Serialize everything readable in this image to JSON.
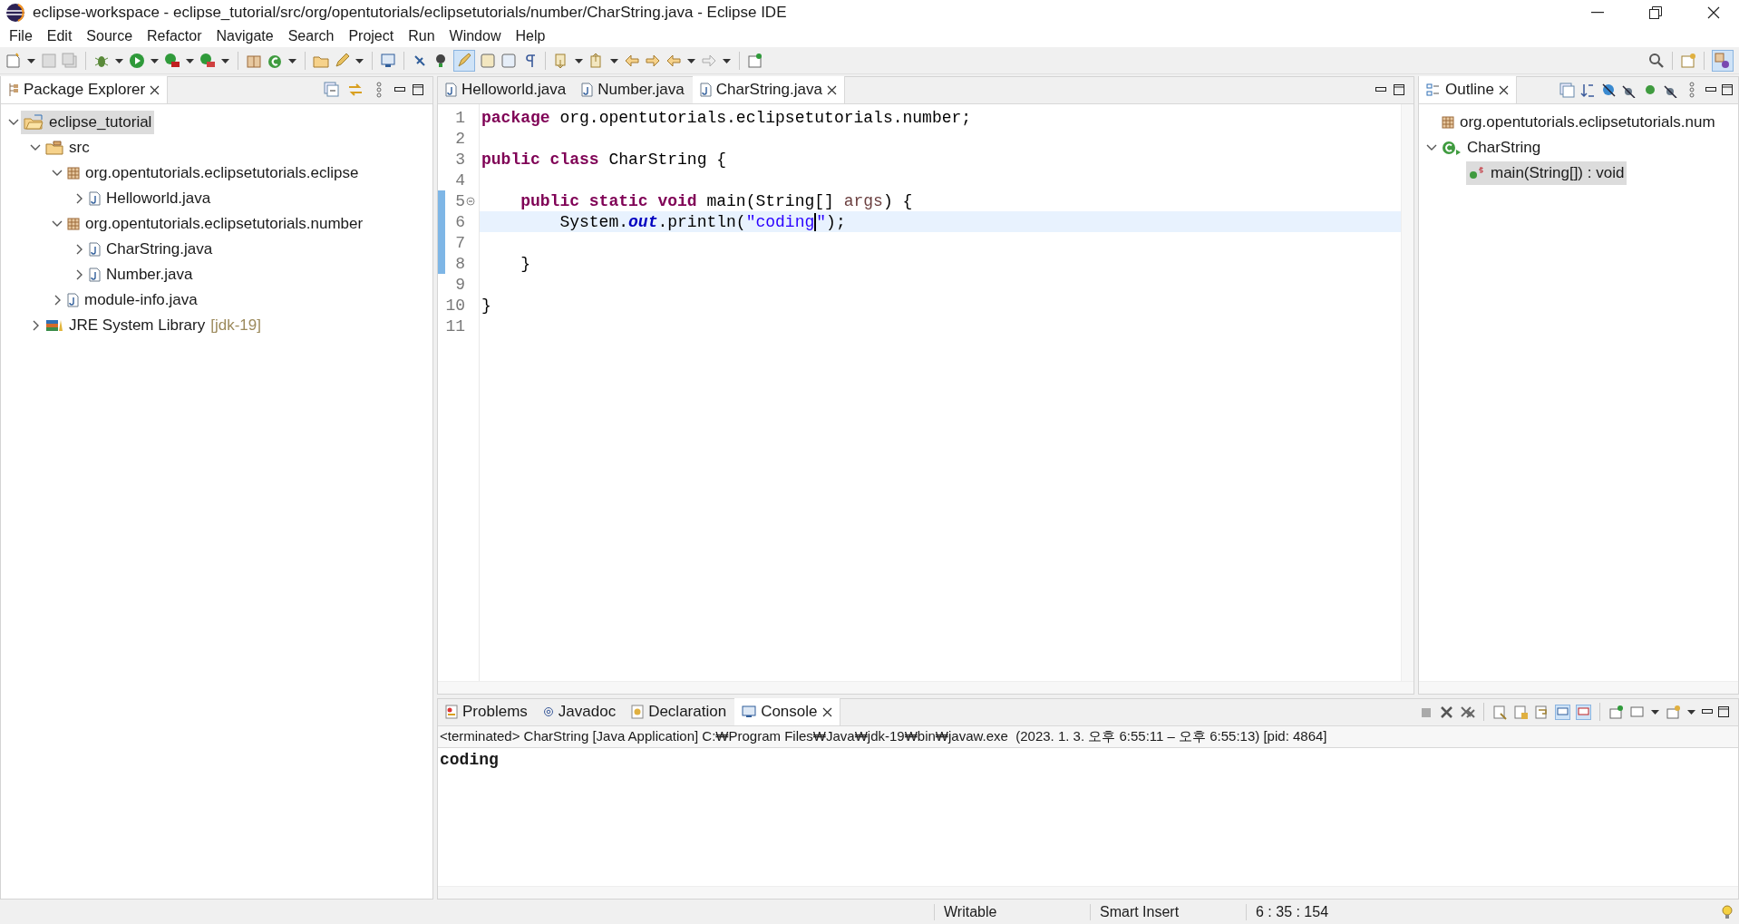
{
  "window": {
    "title": "eclipse-workspace - eclipse_tutorial/src/org/opentutorials/eclipsetutorials/number/CharString.java - Eclipse IDE"
  },
  "menu": [
    "File",
    "Edit",
    "Source",
    "Refactor",
    "Navigate",
    "Search",
    "Project",
    "Run",
    "Window",
    "Help"
  ],
  "package_explorer": {
    "title": "Package Explorer",
    "tree": [
      {
        "label": "eclipse_tutorial",
        "kind": "project",
        "expanded": true,
        "selected": true,
        "children": [
          {
            "label": "src",
            "kind": "folder",
            "expanded": true,
            "selected": false,
            "children": [
              {
                "label": "org.opentutorials.eclipsetutorials.eclipse",
                "kind": "package",
                "expanded": true,
                "selected": false,
                "children": [
                  {
                    "label": "Helloworld.java",
                    "kind": "java",
                    "expanded": false,
                    "selected": false
                  }
                ]
              },
              {
                "label": "org.opentutorials.eclipsetutorials.number",
                "kind": "package",
                "expanded": true,
                "selected": false,
                "children": [
                  {
                    "label": "CharString.java",
                    "kind": "java",
                    "expanded": false,
                    "selected": false
                  },
                  {
                    "label": "Number.java",
                    "kind": "java",
                    "expanded": false,
                    "selected": false
                  }
                ]
              },
              {
                "label": "module-info.java",
                "kind": "java",
                "expanded": false,
                "selected": false
              }
            ]
          },
          {
            "label": "JRE System Library",
            "suffix": "[jdk-19]",
            "kind": "library",
            "expanded": false,
            "selected": false
          }
        ]
      }
    ]
  },
  "editor": {
    "tabs": [
      {
        "label": "Helloworld.java",
        "selected": false
      },
      {
        "label": "Number.java",
        "selected": false
      },
      {
        "label": "CharString.java",
        "selected": true
      }
    ],
    "lines": [
      {
        "number": "1",
        "current": false,
        "marked": false,
        "tokens": [
          {
            "kind": "keyword",
            "text": "package"
          },
          {
            "kind": "plain",
            "text": " org.opentutorials.eclipsetutorials.number;"
          }
        ]
      },
      {
        "number": "2",
        "current": false,
        "marked": false
      },
      {
        "number": "3",
        "current": false,
        "marked": false,
        "tokens": [
          {
            "kind": "keyword",
            "text": "public class"
          },
          {
            "kind": "plain",
            "text": " CharString {"
          }
        ]
      },
      {
        "number": "4",
        "current": false,
        "marked": false
      },
      {
        "number": "5",
        "current": false,
        "marked": true,
        "fold": true,
        "tokens": [
          {
            "kind": "keyword",
            "text": "    public static void"
          },
          {
            "kind": "plain",
            "text": " main(String[] "
          },
          {
            "kind": "param",
            "text": "args"
          },
          {
            "kind": "plain",
            "text": ") {"
          }
        ]
      },
      {
        "number": "6",
        "current": true,
        "marked": true,
        "tokens": [
          {
            "kind": "plain",
            "text": "        System."
          },
          {
            "kind": "field",
            "text": "out"
          },
          {
            "kind": "plain",
            "text": ".println("
          },
          {
            "kind": "string",
            "text": "\"coding",
            "caret": true
          },
          {
            "kind": "string",
            "text": "\""
          },
          {
            "kind": "plain",
            "text": ");"
          }
        ]
      },
      {
        "number": "7",
        "current": false,
        "marked": true
      },
      {
        "number": "8",
        "current": false,
        "marked": true,
        "tokens": [
          {
            "kind": "plain",
            "text": "    }"
          }
        ]
      },
      {
        "number": "9",
        "current": false,
        "marked": false
      },
      {
        "number": "10",
        "current": false,
        "marked": false,
        "tokens": [
          {
            "kind": "plain",
            "text": "}"
          }
        ]
      },
      {
        "number": "11",
        "current": false,
        "marked": false
      }
    ]
  },
  "outline": {
    "title": "Outline",
    "tree": [
      {
        "label": "org.opentutorials.eclipsetutorials.num",
        "kind": "package",
        "selected": false
      },
      {
        "label": "CharString",
        "kind": "class",
        "expanded": true,
        "selected": false,
        "children": [
          {
            "label": "main(String[]) : void",
            "kind": "method",
            "selected": true
          }
        ]
      }
    ]
  },
  "console": {
    "tabs": [
      {
        "label": "Problems",
        "kind": "problems",
        "selected": false
      },
      {
        "label": "Javadoc",
        "kind": "javadoc",
        "selected": false
      },
      {
        "label": "Declaration",
        "kind": "declaration",
        "selected": false
      },
      {
        "label": "Console",
        "kind": "console",
        "selected": true
      }
    ],
    "header": "<terminated> CharString [Java Application] C:₩Program Files₩Java₩jdk-19₩bin₩javaw.exe  (2023. 1. 3. 오후 6:55:11 – 오후 6:55:13) [pid: 4864]",
    "output": "coding"
  },
  "status_bar": [
    "Writable",
    "Smart Insert",
    "6 : 35 : 154"
  ]
}
